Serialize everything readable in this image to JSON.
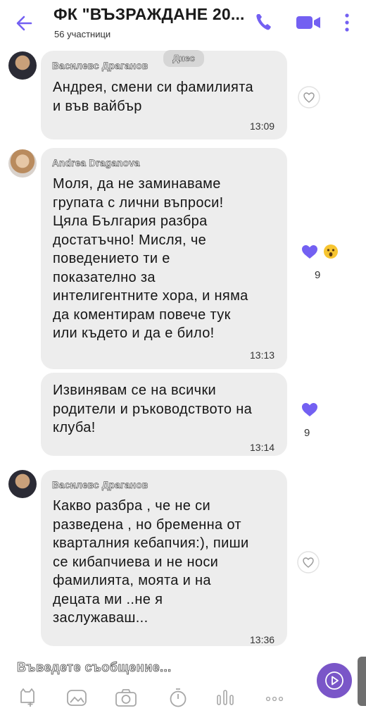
{
  "header": {
    "title": "ФК \"ВЪЗРАЖДАНЕ 20...",
    "subtitle": "56 участници"
  },
  "date_label": "Днес",
  "messages": [
    {
      "sender": "Василевс Драганов",
      "text": "Андрея,  смени си фамилията\nи във вайбър",
      "time": "13:09"
    },
    {
      "sender": "Andrea Draganova",
      "text": "Моля, да не заминаваме\nгрупата с лични въпроси!\nЦяла България разбра\nдостатъчно! Мисля, че\nповедението ти е\nпоказателно за\nинтелигентните хора, и няма\nда коментирам повече тук\nили където и да е било!",
      "time": "13:13",
      "like_count": "9"
    },
    {
      "text": "Извинявам се на всички\nродители и ръководството на\nклуба!",
      "time": "13:14",
      "like_count": "9"
    },
    {
      "sender": "Василевс Драганов",
      "text": "Какво разбра , че не си\nразведена , но бременна от\nкварталния кебапчия:), пиши\nсе кибапчиева и не носи\nфамилията,  моята и на\nдецата ми ..не я\nзаслужаваш...",
      "time": "13:36"
    }
  ],
  "composer": {
    "placeholder": "Въведете съобщение..."
  },
  "icons": {
    "back": "arrow-left-icon",
    "call": "phone-icon",
    "video": "video-camera-icon",
    "more": "more-vertical-icon",
    "like": "heart-icon",
    "surprised": "surprised-emoji-icon",
    "toolbar": [
      "sticker-icon",
      "gallery-icon",
      "camera-icon",
      "timer-icon",
      "voice-icon",
      "more-horizontal-icon"
    ],
    "send": "send-play-icon"
  },
  "colors": {
    "accent": "#7360f2",
    "bubble": "#ededed",
    "send": "#7a56c8"
  }
}
